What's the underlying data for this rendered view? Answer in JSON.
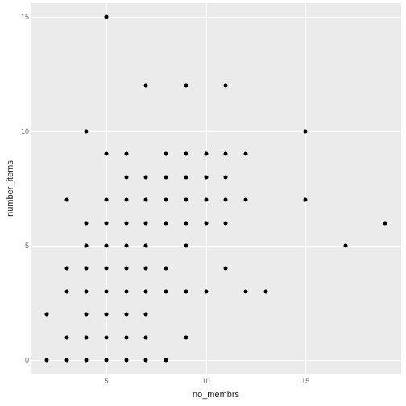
{
  "chart_data": {
    "type": "scatter",
    "xlabel": "no_membrs",
    "ylabel": "number_items",
    "title": "",
    "xlim": [
      1.2,
      19.8
    ],
    "ylim": [
      -0.6,
      15.6
    ],
    "x_ticks": [
      5,
      10,
      15
    ],
    "y_ticks": [
      0,
      5,
      10,
      15
    ],
    "points": [
      {
        "x": 2,
        "y": 0
      },
      {
        "x": 2,
        "y": 2
      },
      {
        "x": 3,
        "y": 0
      },
      {
        "x": 3,
        "y": 1
      },
      {
        "x": 3,
        "y": 3
      },
      {
        "x": 3,
        "y": 4
      },
      {
        "x": 3,
        "y": 7
      },
      {
        "x": 4,
        "y": 0
      },
      {
        "x": 4,
        "y": 1
      },
      {
        "x": 4,
        "y": 2
      },
      {
        "x": 4,
        "y": 3
      },
      {
        "x": 4,
        "y": 4
      },
      {
        "x": 4,
        "y": 5
      },
      {
        "x": 4,
        "y": 6
      },
      {
        "x": 4,
        "y": 10
      },
      {
        "x": 5,
        "y": 0
      },
      {
        "x": 5,
        "y": 1
      },
      {
        "x": 5,
        "y": 2
      },
      {
        "x": 5,
        "y": 3
      },
      {
        "x": 5,
        "y": 4
      },
      {
        "x": 5,
        "y": 5
      },
      {
        "x": 5,
        "y": 6
      },
      {
        "x": 5,
        "y": 7
      },
      {
        "x": 5,
        "y": 9
      },
      {
        "x": 5,
        "y": 15
      },
      {
        "x": 6,
        "y": 0
      },
      {
        "x": 6,
        "y": 1
      },
      {
        "x": 6,
        "y": 2
      },
      {
        "x": 6,
        "y": 3
      },
      {
        "x": 6,
        "y": 4
      },
      {
        "x": 6,
        "y": 5
      },
      {
        "x": 6,
        "y": 6
      },
      {
        "x": 6,
        "y": 7
      },
      {
        "x": 6,
        "y": 8
      },
      {
        "x": 6,
        "y": 9
      },
      {
        "x": 7,
        "y": 0
      },
      {
        "x": 7,
        "y": 1
      },
      {
        "x": 7,
        "y": 2
      },
      {
        "x": 7,
        "y": 3
      },
      {
        "x": 7,
        "y": 4
      },
      {
        "x": 7,
        "y": 5
      },
      {
        "x": 7,
        "y": 6
      },
      {
        "x": 7,
        "y": 7
      },
      {
        "x": 7,
        "y": 8
      },
      {
        "x": 7,
        "y": 12
      },
      {
        "x": 8,
        "y": 0
      },
      {
        "x": 8,
        "y": 3
      },
      {
        "x": 8,
        "y": 4
      },
      {
        "x": 8,
        "y": 6
      },
      {
        "x": 8,
        "y": 7
      },
      {
        "x": 8,
        "y": 8
      },
      {
        "x": 8,
        "y": 9
      },
      {
        "x": 9,
        "y": 1
      },
      {
        "x": 9,
        "y": 3
      },
      {
        "x": 9,
        "y": 5
      },
      {
        "x": 9,
        "y": 6
      },
      {
        "x": 9,
        "y": 7
      },
      {
        "x": 9,
        "y": 8
      },
      {
        "x": 9,
        "y": 9
      },
      {
        "x": 9,
        "y": 12
      },
      {
        "x": 10,
        "y": 3
      },
      {
        "x": 10,
        "y": 6
      },
      {
        "x": 10,
        "y": 7
      },
      {
        "x": 10,
        "y": 8
      },
      {
        "x": 10,
        "y": 9
      },
      {
        "x": 11,
        "y": 4
      },
      {
        "x": 11,
        "y": 6
      },
      {
        "x": 11,
        "y": 7
      },
      {
        "x": 11,
        "y": 8
      },
      {
        "x": 11,
        "y": 9
      },
      {
        "x": 11,
        "y": 12
      },
      {
        "x": 12,
        "y": 3
      },
      {
        "x": 12,
        "y": 7
      },
      {
        "x": 12,
        "y": 9
      },
      {
        "x": 13,
        "y": 3
      },
      {
        "x": 15,
        "y": 7
      },
      {
        "x": 15,
        "y": 10
      },
      {
        "x": 17,
        "y": 5
      },
      {
        "x": 19,
        "y": 6
      }
    ]
  }
}
